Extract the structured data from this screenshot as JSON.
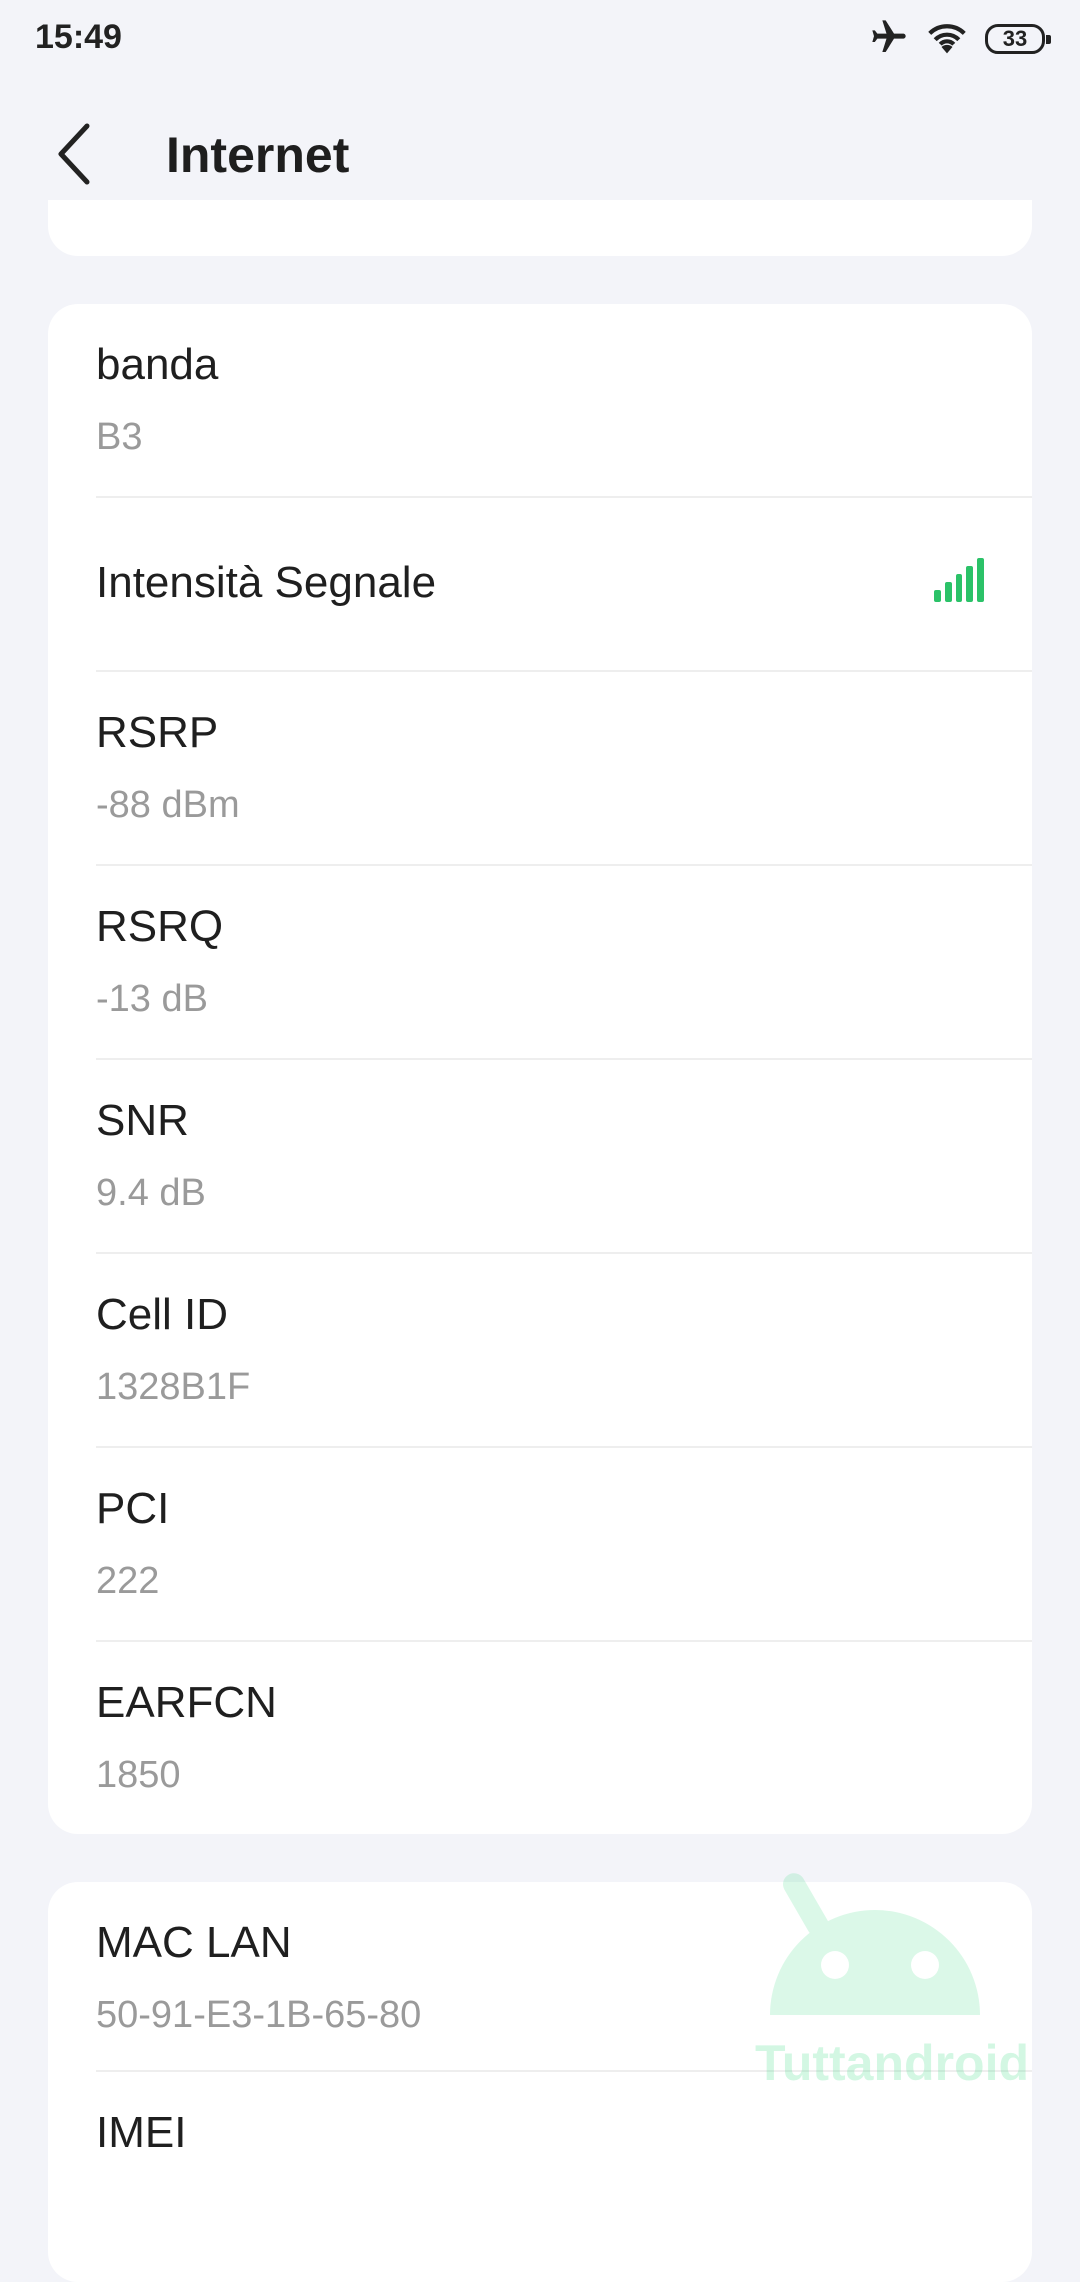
{
  "status_bar": {
    "time": "15:49",
    "battery_level": "33",
    "icons": [
      "airplane-icon",
      "wifi-icon",
      "battery-icon"
    ]
  },
  "header": {
    "title": "Internet",
    "back_icon": "chevron-left-icon"
  },
  "signal_info": {
    "rows": [
      {
        "label": "banda",
        "value": "B3"
      },
      {
        "label": "Intensità Segnale",
        "signal_level": 5,
        "signal_max": 5,
        "signal_color": "#2bc268"
      },
      {
        "label": "RSRP",
        "value": "-88 dBm"
      },
      {
        "label": "RSRQ",
        "value": "-13 dB"
      },
      {
        "label": "SNR",
        "value": "9.4 dB"
      },
      {
        "label": "Cell ID",
        "value": "1328B1F"
      },
      {
        "label": "PCI",
        "value": "222"
      },
      {
        "label": "EARFCN",
        "value": "1850"
      }
    ]
  },
  "device_info": {
    "rows": [
      {
        "label": "MAC LAN",
        "value": "50-91-E3-1B-65-80"
      },
      {
        "label": "IMEI"
      }
    ]
  },
  "watermark": {
    "text": "Tuttandroid",
    "color": "#3ddc84"
  },
  "colors": {
    "background": "#f3f4f9",
    "card": "#ffffff",
    "label": "#1f1f1f",
    "value": "#9a9a9a"
  }
}
